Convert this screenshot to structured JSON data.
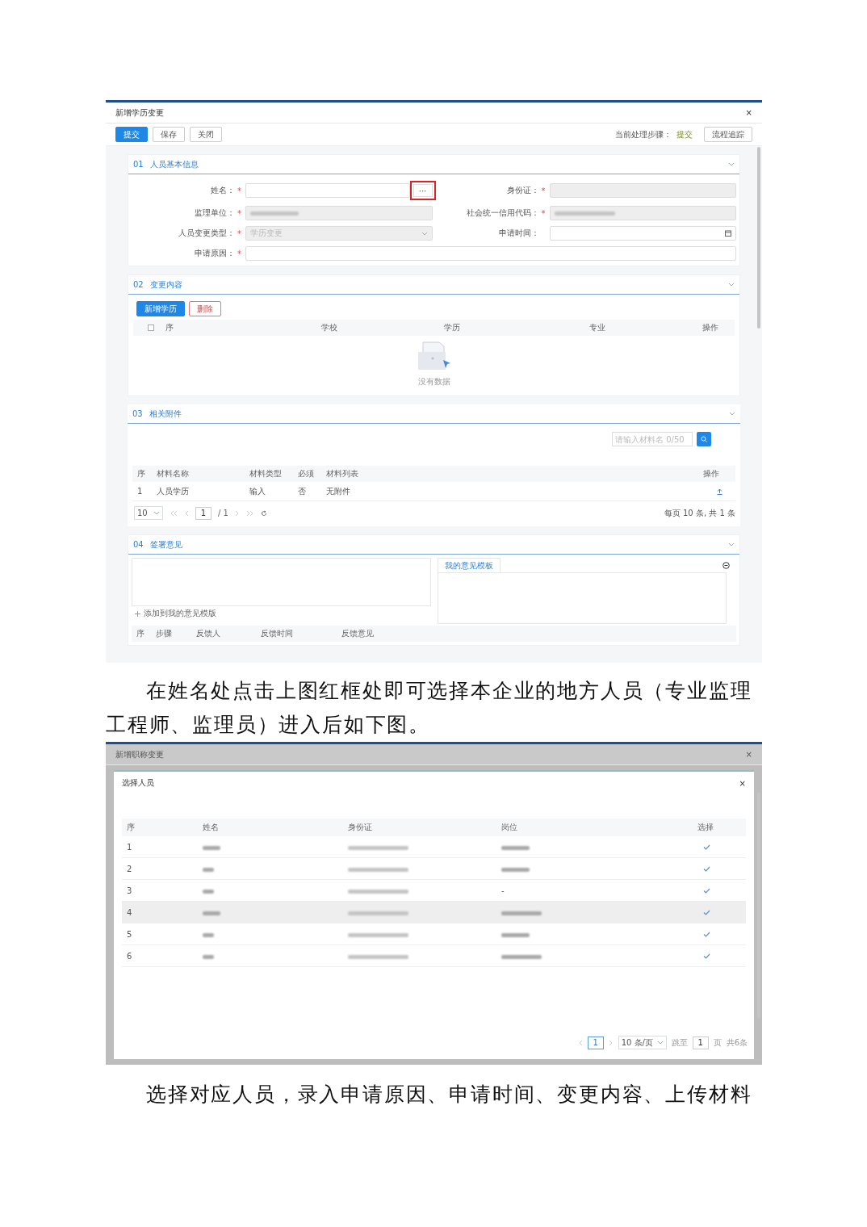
{
  "screenshot_1": {
    "title": "新增学历变更",
    "close": "×",
    "toolbar": [
      {
        "label": "提交",
        "kind": "primary"
      },
      {
        "label": "保存",
        "kind": "default"
      },
      {
        "label": "关闭",
        "kind": "default"
      }
    ],
    "step_label": "当前处理步骤：",
    "step_value": "提交",
    "trace_button": "流程追踪",
    "basic_info": {
      "number": "01",
      "title": "人员基本信息",
      "fields": [
        {
          "label": "姓名：",
          "required_mark": "*",
          "kind": "picker",
          "button": "···",
          "highlighted": true
        },
        {
          "label": "身份证：",
          "required_mark": "*",
          "kind": "disabled"
        },
        {
          "label": "监理单位：",
          "required_mark": "*",
          "kind": "blurred"
        },
        {
          "label": "社会统一信用代码：",
          "required_mark": "*",
          "kind": "blurred"
        },
        {
          "label": "人员变更类型：",
          "required_mark": "*",
          "kind": "select",
          "value": "学历变更"
        },
        {
          "label": "申请时间：",
          "kind": "date"
        },
        {
          "label": "申请原因：",
          "required_mark": "*",
          "kind": "wide"
        }
      ]
    },
    "changes": {
      "number": "02",
      "title": "变更内容",
      "buttons": [
        {
          "label": "新增学历",
          "kind": "primary"
        },
        {
          "label": "删除",
          "kind": "danger"
        }
      ],
      "select_all_checked": false,
      "columns": [
        "序",
        "学校",
        "学历",
        "专业",
        "操作"
      ],
      "empty_text": "没有数据"
    },
    "attachments": {
      "number": "03",
      "title": "相关附件",
      "search_placeholder": "请输入材料名 0/50",
      "columns": [
        "序",
        "材料名称",
        "材料类型",
        "必须",
        "材料列表",
        "操作"
      ],
      "rows": [
        {
          "cells": [
            "1",
            "人员学历",
            "输入",
            "否",
            "无附件"
          ]
        }
      ],
      "page_size": "10",
      "page": "1",
      "page_total": "/ 1",
      "summary": "每页 10 条, 共 1 条"
    },
    "opinion": {
      "number": "04",
      "title": "签署意见",
      "tab": "我的意见模板",
      "add_template": "添加到我的意见模版",
      "columns": [
        "序",
        "步骤",
        "反馈人",
        "反馈时间",
        "反馈意见"
      ]
    }
  },
  "paragraph_1": "在姓名处点击上图红框处即可选择本企业的地方人员（专业监理工程师、监理员）进入后如下图。",
  "screenshot_2": {
    "window_title": "新增职称变更",
    "window_close": "×",
    "dialog_title": "选择人员",
    "dialog_close": "×",
    "columns": [
      "序",
      "姓名",
      "身份证",
      "岗位",
      "选择"
    ],
    "rows": [
      {
        "number": "1",
        "selected": false
      },
      {
        "number": "2",
        "selected": false
      },
      {
        "number": "3",
        "position": "-",
        "selected": false
      },
      {
        "number": "4",
        "selected": true
      },
      {
        "number": "5",
        "selected": false
      },
      {
        "number": "6",
        "selected": false
      }
    ],
    "page": "1",
    "page_size": "10 条/页",
    "goto_label": "跳至",
    "goto_value": "1",
    "goto_unit": "页",
    "total": "共6条"
  },
  "paragraph_2": "选择对应人员，录入申请原因、申请时间、变更内容、上传材料"
}
